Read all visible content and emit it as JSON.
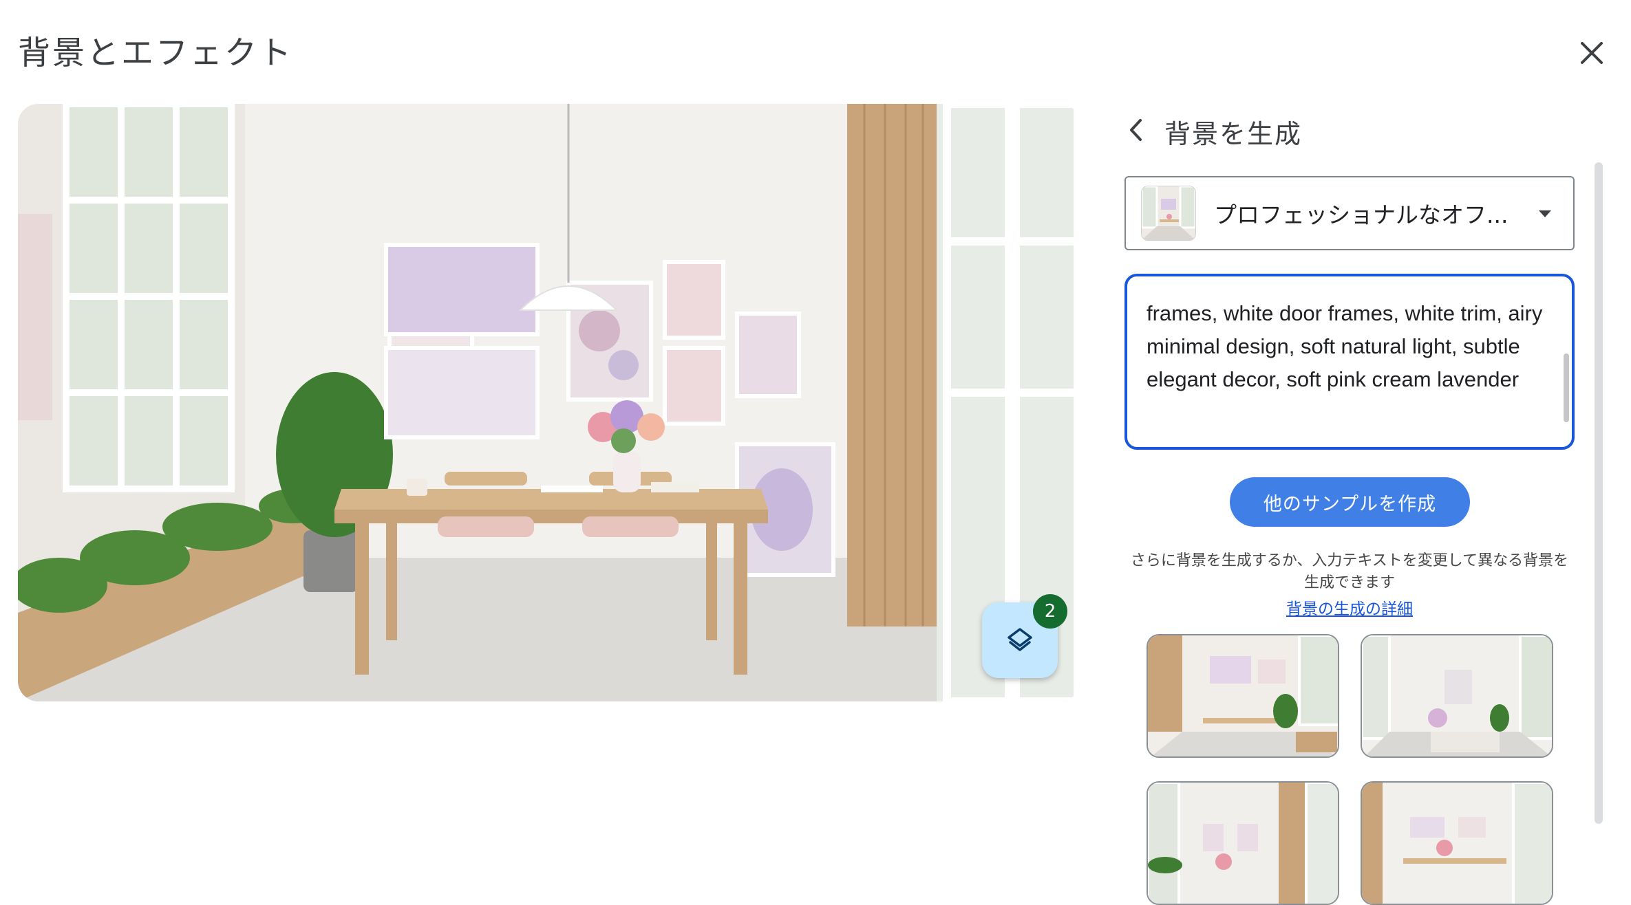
{
  "dialog": {
    "title": "背景とエフェクト"
  },
  "preview": {
    "layers_count": "2"
  },
  "panel": {
    "title": "背景を生成",
    "style_select": {
      "selected": "プロフェッショナルなオフ..."
    },
    "prompt_text": "frames, white door frames, white trim, airy minimal design, soft natural light, subtle elegant decor, soft pink cream lavender",
    "more_samples_button": "他のサンプルを作成",
    "hint_text": "さらに背景を生成するか、入力テキストを変更して異なる背景を生成できます",
    "learn_more_link": "背景の生成の詳細"
  },
  "colors": {
    "accent": "#1a56db",
    "button": "#3f7fe6",
    "fab": "#c2e7ff",
    "badge": "#146c2e"
  }
}
